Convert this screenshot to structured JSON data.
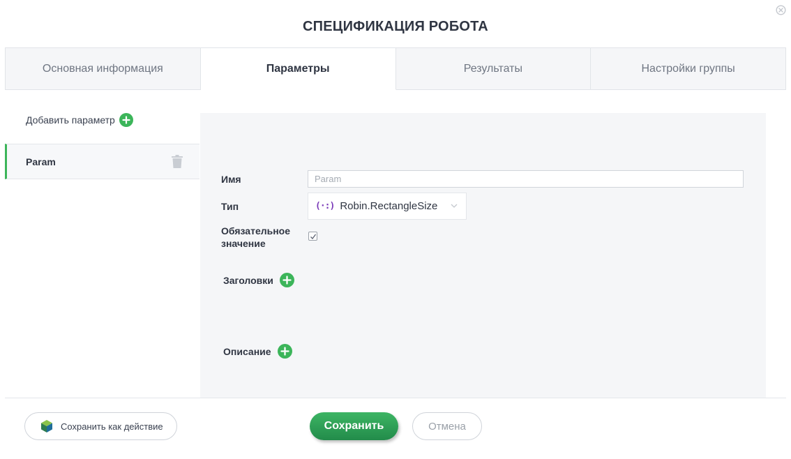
{
  "dialog": {
    "title": "СПЕЦИФИКАЦИЯ РОБОТА",
    "close_icon": "close-circle-icon"
  },
  "tabs": [
    {
      "label": "Основная информация",
      "active": false
    },
    {
      "label": "Параметры",
      "active": true
    },
    {
      "label": "Результаты",
      "active": false
    },
    {
      "label": "Настройки группы",
      "active": false
    }
  ],
  "sidebar": {
    "add_label": "Добавить параметр",
    "items": [
      {
        "label": "Param",
        "selected": true
      }
    ]
  },
  "form": {
    "name_label": "Имя",
    "name_placeholder": "Param",
    "name_value": "",
    "type_label": "Тип",
    "type_glyph": "(·:)",
    "type_value": "Robin.RectangleSize",
    "required_label_line1": "Обязательное",
    "required_label_line2": "значение",
    "required_checked": true,
    "headers_label": "Заголовки",
    "description_label": "Описание"
  },
  "footer": {
    "save_as_action_label": "Сохранить как действие",
    "save_label": "Сохранить",
    "cancel_label": "Отмена"
  },
  "colors": {
    "accent_green": "#3cb55a",
    "type_glyph": "#7a3ab8"
  }
}
